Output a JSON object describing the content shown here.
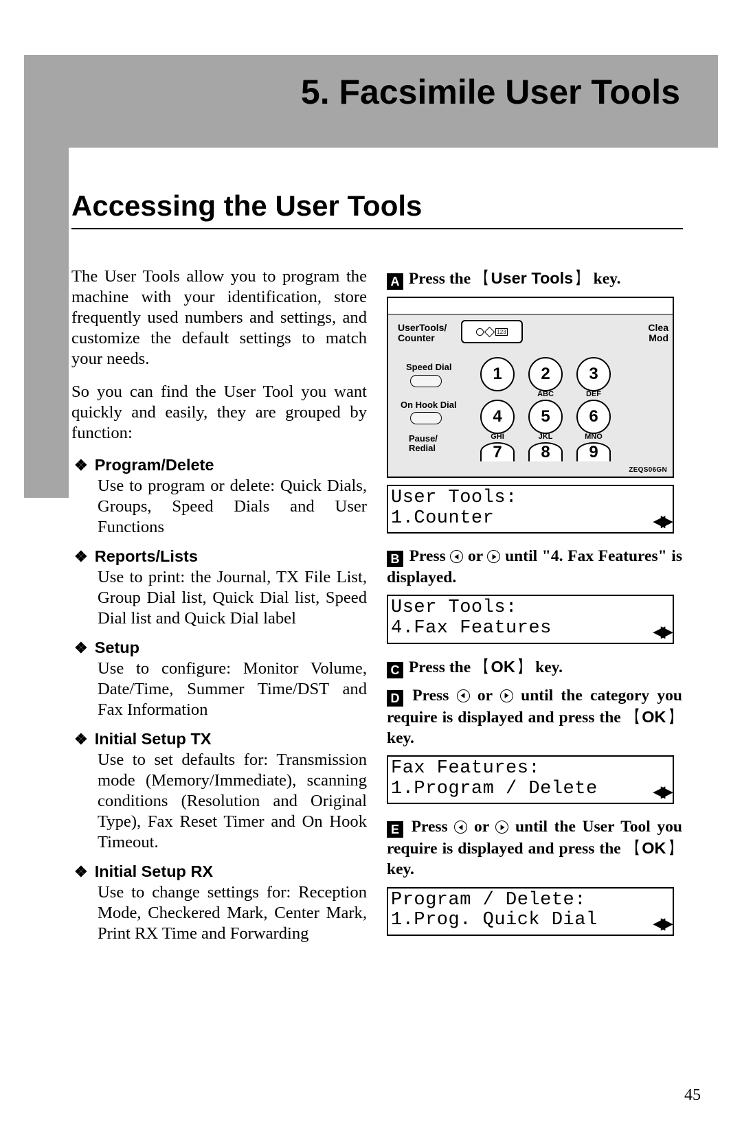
{
  "chapter_title": "5. Facsimile User Tools",
  "section_title": "Accessing the User Tools",
  "intro_1": "The User Tools allow you to program the machine with your identification, store frequently used numbers and settings, and customize the default settings to match your needs.",
  "intro_2": "So you can find the User Tool you want quickly and easily, they are grouped by function:",
  "bullets": [
    {
      "head": "Program/Delete",
      "body": "Use to program or delete: Quick Dials, Groups, Speed Dials and User Functions"
    },
    {
      "head": "Reports/Lists",
      "body": "Use to print: the Journal, TX File List, Group Dial list, Quick Dial list, Speed Dial list and Quick Dial label"
    },
    {
      "head": "Setup",
      "body": "Use to configure: Monitor Volume, Date/Time, Summer Time/DST and Fax Information"
    },
    {
      "head": "Initial Setup TX",
      "body": "Use to set defaults for: Transmission mode (Memory/Immediate), scanning conditions (Resolution and Original Type), Fax Reset Timer and On Hook Timeout."
    },
    {
      "head": "Initial Setup RX",
      "body": "Use to change settings for: Reception Mode, Checkered Mark, Center Mark, Print RX Time and Forwarding"
    }
  ],
  "steps": {
    "s1_pre": "Press the ",
    "s1_key": "User Tools",
    "s1_post": " key.",
    "s2_pre": "Press ",
    "s2_mid": " or ",
    "s2_post": " until \"4. Fax Features\" is displayed.",
    "s3_pre": "Press the ",
    "s3_key": "OK",
    "s3_post": " key.",
    "s4_pre": "Press ",
    "s4_mid": " or ",
    "s4_post_a": " until the category you require is displayed and press the ",
    "s4_key": "OK",
    "s4_post_b": " key.",
    "s5_pre": "Press ",
    "s5_mid": " or ",
    "s5_post_a": " until the User Tool you require is displayed and press the ",
    "s5_key": "OK",
    "s5_post_b": " key."
  },
  "device": {
    "ut_label_1": "UserTools/",
    "ut_label_2": "Counter",
    "btn_123": "123",
    "clea_1": "Clea",
    "clea_2": "Mod",
    "speed_dial": "Speed Dial",
    "on_hook": "On Hook Dial",
    "pause_1": "Pause/",
    "pause_2": "Redial",
    "keys": [
      "1",
      "2",
      "3",
      "4",
      "5",
      "6",
      "7",
      "8",
      "9"
    ],
    "subs": [
      "",
      "ABC",
      "DEF",
      "GHI",
      "JKL",
      "MNO"
    ],
    "code": "ZEQS06GN"
  },
  "lcds": {
    "a1": "User Tools:",
    "a2": "1.Counter",
    "b1": "User Tools:",
    "b2": "4.Fax Features",
    "c1": "Fax Features:",
    "c2": "1.Program / Delete",
    "d1": "Program / Delete:",
    "d2": "1.Prog. Quick Dial"
  },
  "arrow_text": "◀▶",
  "page_number": "45"
}
